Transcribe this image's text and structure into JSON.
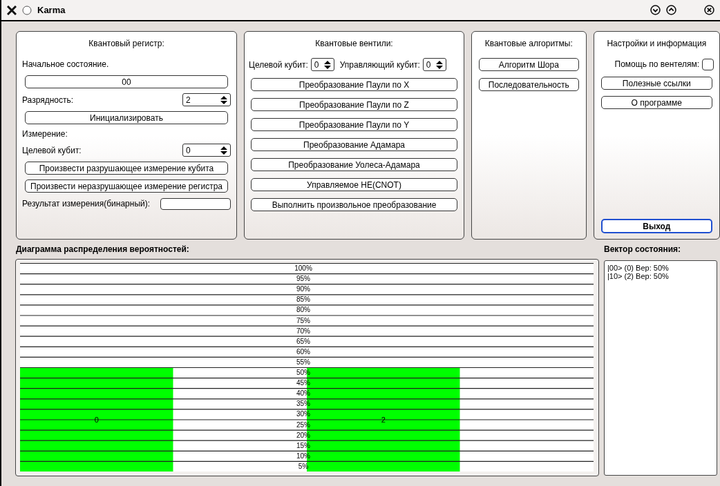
{
  "window": {
    "title": "Karma"
  },
  "register": {
    "title": "Квантовый регистр:",
    "initial_label": "Начальное состояние.",
    "initial_value": "00",
    "bits_label": "Разрядность:",
    "bits_value": "2",
    "init_button": "Инициализировать",
    "measure_label": "Измерение:",
    "target_label": "Целевой кубит:",
    "target_value": "0",
    "buttons": [
      "Произвести разрушающее измерение кубита",
      "Произвести неразрушающее измерение регистра"
    ],
    "result_label": "Результат измерения(бинарный):"
  },
  "gates": {
    "title": "Квантовые вентили:",
    "target_label": "Целевой кубит:",
    "target_value": "0",
    "control_label": "Управляющий кубит:",
    "control_value": "0",
    "buttons": [
      "Преобразование Паули по X",
      "Преобразование Паули по Z",
      "Преобразование Паули по Y",
      "Преобразование Адамара",
      "Преобразование Уолеса-Адамара",
      "Управляемое НЕ(CNOT)",
      "Выполнить произвольное преобразование"
    ]
  },
  "algorithms": {
    "title": "Квантовые алгоритмы:",
    "buttons": [
      "Алгоритм Шора",
      "Последовательность"
    ]
  },
  "settings": {
    "title": "Настройки и информация",
    "help_label": "Помощь по вентелям:",
    "help_checked": false,
    "buttons": [
      "Полезные ссылки",
      "О программе"
    ],
    "exit_button": {
      "label": "Выход",
      "focused": true
    }
  },
  "chart_panel": {
    "title": "Диаграмма распределения вероятностей:",
    "chart_data": {
      "type": "bar",
      "categories": [
        "0",
        "2"
      ],
      "ylim": [
        0,
        100
      ],
      "grid": true,
      "series": [
        {
          "color": "#00ff00",
          "values": [
            50,
            50
          ]
        }
      ],
      "yticks": [
        {
          "value": 5,
          "label": "5%"
        },
        {
          "value": 10,
          "label": "10%"
        },
        {
          "value": 15,
          "label": "15%"
        },
        {
          "value": 20,
          "label": "20%"
        },
        {
          "value": 25,
          "label": "25%"
        },
        {
          "value": 30,
          "label": "30%"
        },
        {
          "value": 35,
          "label": "35%"
        },
        {
          "value": 40,
          "label": "40%"
        },
        {
          "value": 45,
          "label": "45%"
        },
        {
          "value": 50,
          "label": "50%"
        },
        {
          "value": 55,
          "label": "55%"
        },
        {
          "value": 60,
          "label": "60%"
        },
        {
          "value": 65,
          "label": "65%"
        },
        {
          "value": 70,
          "label": "70%"
        },
        {
          "value": 75,
          "label": "75%"
        },
        {
          "value": 80,
          "label": "80%"
        },
        {
          "value": 85,
          "label": "85%"
        },
        {
          "value": 90,
          "label": "90%"
        },
        {
          "value": 95,
          "label": "95%"
        },
        {
          "value": 100,
          "label": "100%"
        }
      ]
    }
  },
  "state_vector": {
    "title": "Вектор состояния:",
    "lines": [
      "|00> (0) Вер: 50%",
      "|10> (2) Вер: 50%"
    ]
  }
}
